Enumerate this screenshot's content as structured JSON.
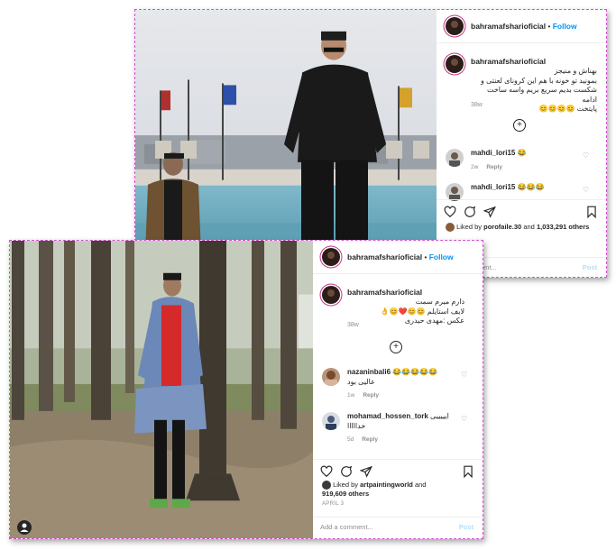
{
  "post1": {
    "username": "bahramafsharioficial",
    "separator": "•",
    "follow_label": "Follow",
    "caption_line1": "بهناش و منیجز",
    "caption_line2": "بمونید تو خونه با هم این کرونای لعنتی و",
    "caption_line3": "شکست بدیم سریع بریم واسه ساخت ادامه",
    "caption_line4": "پایتخت 😊😊😊😊",
    "time_ago": "38w",
    "comments": [
      {
        "username": "mahdi_lori15",
        "text": "😂",
        "time": "2w",
        "reply_label": "Reply"
      },
      {
        "username": "mahdi_lori15",
        "text": "😂😂😂",
        "time": "",
        "reply_label": ""
      }
    ],
    "liked_by_prefix": "Liked by",
    "liked_by_user": "porofaile.30",
    "liked_and": "and",
    "likes_count": "1,033,291 others",
    "add_comment_placeholder": "Add a comment...",
    "post_label": "Post"
  },
  "post2": {
    "username": "bahramafsharioficial",
    "separator": "•",
    "follow_label": "Follow",
    "caption_line1": "دارم میرم سمت",
    "caption_line2": "لایف استایلم 😊😊❤️😊👌",
    "caption_line3": "عکس :مهدی حیدری",
    "time_ago": "38w",
    "comments": [
      {
        "username": "nazaninbali6",
        "text": "😂😂😂😂😂",
        "text2": "عالیی بود",
        "time": "1w",
        "reply_label": "Reply"
      },
      {
        "username": "mohamad_hossen_tork",
        "text": "ایییییی",
        "text2": "خدااااا",
        "time": "5d",
        "reply_label": "Reply"
      }
    ],
    "liked_by_prefix": "Liked by",
    "liked_by_user": "artpaintingworld",
    "liked_and": "and",
    "likes_count": "919,609 others",
    "date": "APRIL 3",
    "add_comment_placeholder": "Add a comment...",
    "post_label": "Post"
  },
  "icons": [
    "heart-icon",
    "comment-icon",
    "share-icon",
    "bookmark-icon",
    "more-icon",
    "plus-circle-icon",
    "user-tag-icon"
  ],
  "colors": {
    "follow": "#0095f6",
    "frame": "#d14fd1",
    "story_ring": "#c13584",
    "muted": "#8e8e8e"
  }
}
